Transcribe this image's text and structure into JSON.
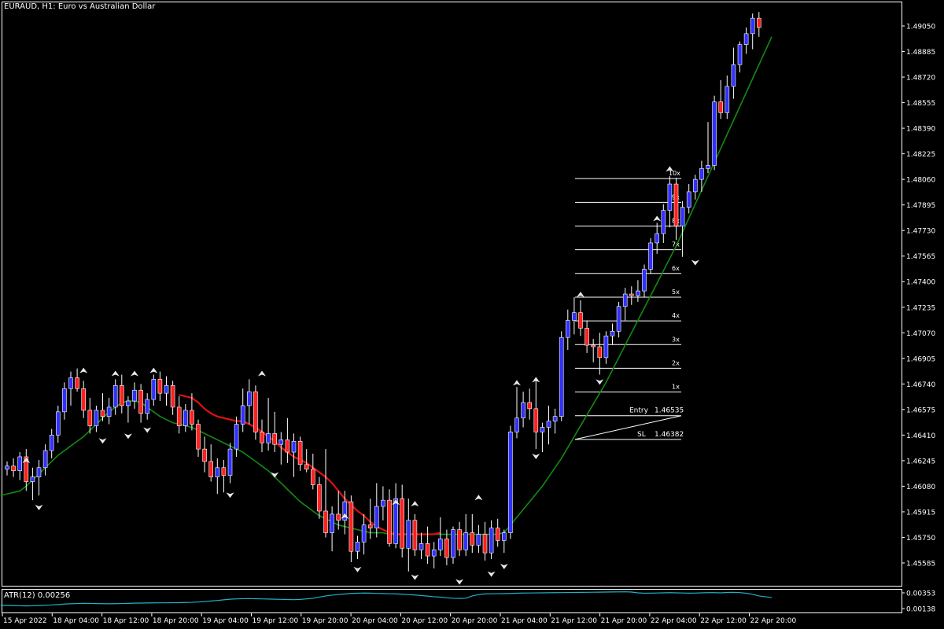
{
  "window": {
    "symbol_title": "EURAUD, H1:  Euro vs Australian Dollar"
  },
  "colors": {
    "background": "#000000",
    "bull_body": "#3030ff",
    "bear_body": "#ff2020",
    "wick": "#ffffff",
    "ma_fast": "#e01010",
    "ma_slow": "#138a13",
    "atr_line": "#20b2c8",
    "grid_lines": "#ffffff"
  },
  "price_axis": {
    "labels": [
      "1.49050",
      "1.48885",
      "1.48720",
      "1.48555",
      "1.48390",
      "1.48225",
      "1.48060",
      "1.47895",
      "1.47730",
      "1.47565",
      "1.47400",
      "1.47235",
      "1.47070",
      "1.46905",
      "1.46740",
      "1.46575",
      "1.46410",
      "1.46245",
      "1.46080",
      "1.45915",
      "1.45750",
      "1.45585"
    ],
    "values": [
      1.4905,
      1.48885,
      1.4872,
      1.48555,
      1.4839,
      1.48225,
      1.4806,
      1.47895,
      1.4773,
      1.47565,
      1.474,
      1.47235,
      1.4707,
      1.46905,
      1.4674,
      1.46575,
      1.4641,
      1.46245,
      1.4608,
      1.45915,
      1.4575,
      1.45585
    ]
  },
  "time_axis": {
    "labels": [
      "15 Apr 2022",
      "18 Apr 04:00",
      "18 Apr 12:00",
      "18 Apr 20:00",
      "19 Apr 04:00",
      "19 Apr 12:00",
      "19 Apr 20:00",
      "20 Apr 04:00",
      "20 Apr 12:00",
      "20 Apr 20:00",
      "21 Apr 04:00",
      "21 Apr 12:00",
      "21 Apr 20:00",
      "22 Apr 04:00",
      "22 Apr 12:00",
      "22 Apr 20:00"
    ]
  },
  "indicator": {
    "title": "ATR(12) 0.00256",
    "axis_labels": [
      "0.00353",
      "0.00138"
    ]
  },
  "levels": {
    "entry_label": "Entry",
    "entry_value": "1.46535",
    "sl_label": "SL",
    "sl_value": "1.46382",
    "multiples": [
      "1x",
      "2x",
      "3x",
      "4x",
      "5x",
      "6x",
      "7x",
      "8x",
      "9x",
      "10x"
    ]
  },
  "chart_data": {
    "type": "candlestick",
    "symbol": "EURAUD",
    "timeframe": "H1",
    "price_range": [
      1.455,
      1.4917
    ],
    "candles": [
      [
        1.4619,
        1.4624,
        1.4615,
        1.4621
      ],
      [
        1.4621,
        1.4626,
        1.4614,
        1.4618
      ],
      [
        1.4618,
        1.463,
        1.4612,
        1.4627
      ],
      [
        1.4627,
        1.4632,
        1.4605,
        1.4611
      ],
      [
        1.4611,
        1.462,
        1.4599,
        1.4614
      ],
      [
        1.4614,
        1.4625,
        1.4602,
        1.462
      ],
      [
        1.462,
        1.4635,
        1.4615,
        1.4631
      ],
      [
        1.4631,
        1.4645,
        1.4626,
        1.4641
      ],
      [
        1.4641,
        1.466,
        1.4636,
        1.4656
      ],
      [
        1.4656,
        1.4675,
        1.4651,
        1.4671
      ],
      [
        1.4671,
        1.4682,
        1.466,
        1.4678
      ],
      [
        1.4678,
        1.4684,
        1.4669,
        1.4671
      ],
      [
        1.4671,
        1.4676,
        1.4652,
        1.4657
      ],
      [
        1.4657,
        1.4665,
        1.4642,
        1.4647
      ],
      [
        1.4647,
        1.466,
        1.4643,
        1.4657
      ],
      [
        1.4657,
        1.4668,
        1.465,
        1.4653
      ],
      [
        1.4653,
        1.4665,
        1.4648,
        1.4659
      ],
      [
        1.4659,
        1.4677,
        1.4654,
        1.4673
      ],
      [
        1.4673,
        1.468,
        1.4655,
        1.466
      ],
      [
        1.466,
        1.4666,
        1.4649,
        1.4663
      ],
      [
        1.4663,
        1.4675,
        1.4658,
        1.467
      ],
      [
        1.467,
        1.4674,
        1.4649,
        1.4655
      ],
      [
        1.4655,
        1.4668,
        1.4651,
        1.4664
      ],
      [
        1.4664,
        1.468,
        1.466,
        1.4677
      ],
      [
        1.4677,
        1.4682,
        1.4663,
        1.4668
      ],
      [
        1.4668,
        1.4679,
        1.466,
        1.4673
      ],
      [
        1.4673,
        1.4676,
        1.4654,
        1.4659
      ],
      [
        1.4659,
        1.4666,
        1.4642,
        1.4647
      ],
      [
        1.4647,
        1.4661,
        1.4643,
        1.4657
      ],
      [
        1.4657,
        1.4668,
        1.4644,
        1.4648
      ],
      [
        1.4648,
        1.4651,
        1.4627,
        1.4632
      ],
      [
        1.4632,
        1.464,
        1.4617,
        1.4624
      ],
      [
        1.4624,
        1.4635,
        1.4611,
        1.4614
      ],
      [
        1.4614,
        1.4626,
        1.4603,
        1.462
      ],
      [
        1.462,
        1.4625,
        1.4604,
        1.4615
      ],
      [
        1.4615,
        1.4636,
        1.461,
        1.4632
      ],
      [
        1.4632,
        1.4653,
        1.4627,
        1.4648
      ],
      [
        1.4648,
        1.4671,
        1.4643,
        1.466
      ],
      [
        1.466,
        1.4677,
        1.4648,
        1.4669
      ],
      [
        1.4669,
        1.4673,
        1.4638,
        1.4643
      ],
      [
        1.4643,
        1.4651,
        1.463,
        1.4636
      ],
      [
        1.4636,
        1.4665,
        1.4631,
        1.4642
      ],
      [
        1.4642,
        1.4656,
        1.463,
        1.4635
      ],
      [
        1.4635,
        1.4643,
        1.4622,
        1.4638
      ],
      [
        1.4638,
        1.4652,
        1.4623,
        1.463
      ],
      [
        1.463,
        1.4642,
        1.4614,
        1.4637
      ],
      [
        1.4637,
        1.464,
        1.4618,
        1.4622
      ],
      [
        1.4622,
        1.4632,
        1.4617,
        1.4619
      ],
      [
        1.4619,
        1.4629,
        1.4606,
        1.4609
      ],
      [
        1.4609,
        1.4614,
        1.4587,
        1.4592
      ],
      [
        1.4592,
        1.4632,
        1.4575,
        1.4578
      ],
      [
        1.4578,
        1.4595,
        1.4566,
        1.459
      ],
      [
        1.459,
        1.4605,
        1.458,
        1.4586
      ],
      [
        1.4586,
        1.4605,
        1.4577,
        1.4598
      ],
      [
        1.4598,
        1.4602,
        1.4559,
        1.4566
      ],
      [
        1.4566,
        1.4576,
        1.4561,
        1.4572
      ],
      [
        1.4572,
        1.459,
        1.4564,
        1.4583
      ],
      [
        1.4583,
        1.46,
        1.4574,
        1.4581
      ],
      [
        1.4581,
        1.461,
        1.4575,
        1.4595
      ],
      [
        1.4595,
        1.4608,
        1.4586,
        1.4599
      ],
      [
        1.4599,
        1.4606,
        1.4569,
        1.4571
      ],
      [
        1.4571,
        1.461,
        1.4568,
        1.46
      ],
      [
        1.46,
        1.4609,
        1.4562,
        1.4568
      ],
      [
        1.4568,
        1.46,
        1.4553,
        1.4586
      ],
      [
        1.4586,
        1.459,
        1.4563,
        1.4567
      ],
      [
        1.4567,
        1.4578,
        1.4561,
        1.4571
      ],
      [
        1.4571,
        1.4582,
        1.4558,
        1.4563
      ],
      [
        1.4563,
        1.4572,
        1.4555,
        1.4567
      ],
      [
        1.4567,
        1.4588,
        1.4563,
        1.4574
      ],
      [
        1.4574,
        1.458,
        1.4557,
        1.4562
      ],
      [
        1.4562,
        1.4582,
        1.4558,
        1.458
      ],
      [
        1.458,
        1.4585,
        1.4563,
        1.4567
      ],
      [
        1.4567,
        1.459,
        1.4563,
        1.4578
      ],
      [
        1.4578,
        1.459,
        1.4565,
        1.457
      ],
      [
        1.457,
        1.4583,
        1.4565,
        1.4577
      ],
      [
        1.4577,
        1.4585,
        1.456,
        1.4565
      ],
      [
        1.4565,
        1.4586,
        1.4561,
        1.4581
      ],
      [
        1.4581,
        1.4587,
        1.4569,
        1.4573
      ],
      [
        1.4573,
        1.458,
        1.4565,
        1.4578
      ],
      [
        1.4578,
        1.4647,
        1.4574,
        1.4643
      ],
      [
        1.4643,
        1.4672,
        1.4639,
        1.4652
      ],
      [
        1.4652,
        1.4669,
        1.4646,
        1.4662
      ],
      [
        1.4662,
        1.4671,
        1.4651,
        1.4658
      ],
      [
        1.4658,
        1.4676,
        1.4632,
        1.4643
      ],
      [
        1.4643,
        1.4649,
        1.463,
        1.4646
      ],
      [
        1.4646,
        1.466,
        1.4635,
        1.465
      ],
      [
        1.465,
        1.4658,
        1.4642,
        1.4653
      ],
      [
        1.4653,
        1.4708,
        1.465,
        1.4704
      ],
      [
        1.4704,
        1.4722,
        1.4696,
        1.4715
      ],
      [
        1.4715,
        1.473,
        1.4706,
        1.472
      ],
      [
        1.472,
        1.4728,
        1.4705,
        1.471
      ],
      [
        1.471,
        1.4715,
        1.4694,
        1.4699
      ],
      [
        1.4699,
        1.4703,
        1.4688,
        1.4698
      ],
      [
        1.4698,
        1.4707,
        1.468,
        1.4691
      ],
      [
        1.4691,
        1.4708,
        1.4687,
        1.4705
      ],
      [
        1.4705,
        1.4713,
        1.4699,
        1.4708
      ],
      [
        1.4708,
        1.4727,
        1.4704,
        1.4724
      ],
      [
        1.4724,
        1.4736,
        1.4715,
        1.4732
      ],
      [
        1.4732,
        1.4737,
        1.4725,
        1.4731
      ],
      [
        1.4731,
        1.4741,
        1.4727,
        1.4734
      ],
      [
        1.4734,
        1.4751,
        1.473,
        1.4748
      ],
      [
        1.4748,
        1.4768,
        1.4745,
        1.4765
      ],
      [
        1.4765,
        1.4778,
        1.4758,
        1.4771
      ],
      [
        1.4771,
        1.479,
        1.4765,
        1.4786
      ],
      [
        1.4786,
        1.4808,
        1.4775,
        1.4803
      ],
      [
        1.4803,
        1.4807,
        1.4767,
        1.4776
      ],
      [
        1.4776,
        1.4792,
        1.4756,
        1.4788
      ],
      [
        1.4788,
        1.4803,
        1.4784,
        1.4798
      ],
      [
        1.4798,
        1.4809,
        1.4793,
        1.4806
      ],
      [
        1.4806,
        1.4818,
        1.4798,
        1.4813
      ],
      [
        1.4813,
        1.4843,
        1.481,
        1.4815
      ],
      [
        1.4815,
        1.486,
        1.4812,
        1.4856
      ],
      [
        1.4856,
        1.487,
        1.4845,
        1.4849
      ],
      [
        1.4849,
        1.4873,
        1.4845,
        1.4866
      ],
      [
        1.4866,
        1.4891,
        1.4858,
        1.488
      ],
      [
        1.488,
        1.4895,
        1.4875,
        1.4893
      ],
      [
        1.4893,
        1.4904,
        1.4887,
        1.49
      ],
      [
        1.49,
        1.4913,
        1.489,
        1.491
      ],
      [
        1.491,
        1.4914,
        1.4898,
        1.4904
      ]
    ],
    "ma_fast": [
      1.4667,
      1.4666,
      1.4665,
      1.4662,
      1.4658,
      1.4655,
      1.4653,
      1.4652,
      1.4651,
      1.465,
      1.465,
      1.4648,
      1.4646,
      1.4643,
      1.464,
      1.4637,
      1.4633,
      1.463,
      1.4627,
      1.4625,
      1.4623,
      1.462,
      1.4617,
      1.4614,
      1.461,
      1.4605,
      1.46,
      1.4596,
      1.4592,
      1.4589,
      1.4585,
      1.4582,
      1.458,
      1.4578,
      1.4577,
      1.4577,
      1.4577,
      1.4577,
      1.4577,
      1.4577,
      1.4577,
      1.4578
    ],
    "ma_fast_start_index": 30,
    "ma_slow": [
      1.4602,
      1.4603,
      1.4604,
      1.4605,
      1.4608,
      1.4612,
      1.4616,
      1.462,
      1.4624,
      1.4628,
      1.4631,
      1.4634,
      1.4637,
      1.464,
      1.4644,
      1.4648,
      1.4652,
      1.4656,
      1.4659,
      1.4662,
      1.4663,
      1.4663,
      1.4662,
      1.4659,
      1.4656,
      1.4653,
      1.4651,
      1.4649,
      1.4648,
      1.4647,
      1.4646,
      1.4644,
      1.4642,
      1.464,
      1.4638,
      1.4636,
      1.4634,
      1.4632,
      1.463,
      1.4627,
      1.4624,
      1.4621,
      1.4618,
      1.4614,
      1.461,
      1.4606,
      1.4602,
      1.4598,
      1.4595,
      1.4592,
      1.4589,
      1.4587,
      1.4585,
      1.4583,
      1.4582,
      1.4581,
      1.458,
      1.4579,
      1.4578,
      1.4578,
      1.4578,
      1.4577,
      1.4577,
      1.4577,
      1.4577,
      1.4577,
      1.4577,
      1.4577,
      1.4577,
      1.4577,
      1.4577,
      1.4577,
      1.4577,
      1.4577,
      1.4577,
      1.4577,
      1.4577,
      1.4577,
      1.4577,
      1.4578,
      1.4583,
      1.4588,
      1.4593,
      1.4598,
      1.4603,
      1.4608,
      1.4614,
      1.462,
      1.4626,
      1.4633,
      1.464,
      1.4647,
      1.4654,
      1.4661,
      1.4668,
      1.4675,
      1.4683,
      1.4691,
      1.4699,
      1.4707,
      1.4715,
      1.4723,
      1.4731,
      1.4739,
      1.4747,
      1.4755,
      1.4763,
      1.4772,
      1.4781,
      1.479,
      1.4799,
      1.4808,
      1.4817,
      1.4826,
      1.4835,
      1.4844,
      1.4853,
      1.4862,
      1.4871,
      1.488,
      1.4889,
      1.4898
    ],
    "atr": [
      0.0018,
      0.00178,
      0.00176,
      0.00174,
      0.00172,
      0.00174,
      0.00176,
      0.0018,
      0.00184,
      0.0019,
      0.00196,
      0.002,
      0.00203,
      0.00205,
      0.00204,
      0.00202,
      0.00201,
      0.002,
      0.00201,
      0.00203,
      0.00205,
      0.00207,
      0.00209,
      0.0021,
      0.00211,
      0.00212,
      0.00212,
      0.00213,
      0.00214,
      0.00216,
      0.00218,
      0.00222,
      0.00228,
      0.00235,
      0.00242,
      0.0025,
      0.00258,
      0.00262,
      0.00265,
      0.00266,
      0.00264,
      0.00262,
      0.0026,
      0.00258,
      0.00256,
      0.00254,
      0.00252,
      0.00255,
      0.00262,
      0.0027,
      0.00285,
      0.003,
      0.0031,
      0.00318,
      0.00325,
      0.00332,
      0.00335,
      0.00337,
      0.00336,
      0.00333,
      0.0033,
      0.00328,
      0.00326,
      0.00322,
      0.00318,
      0.00312,
      0.00305,
      0.00298,
      0.0029,
      0.00284,
      0.00276,
      0.0027,
      0.00268,
      0.0027,
      0.003,
      0.00318,
      0.00326,
      0.00328,
      0.00329,
      0.0033,
      0.00332,
      0.00335,
      0.00337,
      0.00338,
      0.00339,
      0.0034,
      0.00341,
      0.00342,
      0.00343,
      0.00344,
      0.00345,
      0.00346,
      0.00347,
      0.00348,
      0.00349,
      0.0035,
      0.00351,
      0.00352,
      0.00353,
      0.0035,
      0.0034,
      0.00335,
      0.00336,
      0.00338,
      0.0034,
      0.00342,
      0.0034,
      0.00338,
      0.00336,
      0.00337,
      0.0034,
      0.00342,
      0.00342,
      0.0034,
      0.00345,
      0.00346,
      0.00343,
      0.00335,
      0.0032,
      0.003,
      0.0029,
      0.0028
    ],
    "atr_range": [
      0.00138,
      0.0036
    ],
    "arrows_up": [
      [
        3,
        1.4624
      ],
      [
        12,
        1.4682
      ],
      [
        17,
        1.468
      ],
      [
        20,
        1.468
      ],
      [
        23,
        1.4682
      ],
      [
        40,
        1.468
      ],
      [
        53,
        1.4588
      ],
      [
        61,
        1.4597
      ],
      [
        64,
        1.4596
      ],
      [
        74,
        1.46
      ],
      [
        80,
        1.4674
      ],
      [
        83,
        1.4676
      ],
      [
        90,
        1.4731
      ],
      [
        102,
        1.478
      ],
      [
        104,
        1.4812
      ]
    ],
    "arrows_down": [
      [
        5,
        1.4595
      ],
      [
        15,
        1.4638
      ],
      [
        19,
        1.4641
      ],
      [
        22,
        1.4645
      ],
      [
        35,
        1.4603
      ],
      [
        42,
        1.4616
      ],
      [
        55,
        1.4555
      ],
      [
        64,
        1.455
      ],
      [
        71,
        1.4547
      ],
      [
        76,
        1.4552
      ],
      [
        78,
        1.4557
      ],
      [
        83,
        1.4628
      ],
      [
        93,
        1.4676
      ],
      [
        108,
        1.4753
      ]
    ],
    "level_prices": [
      1.46535,
      1.46382,
      1.46688,
      1.46841,
      1.46994,
      1.47147,
      1.473,
      1.47453,
      1.47606,
      1.47759,
      1.47912,
      1.48065
    ]
  }
}
